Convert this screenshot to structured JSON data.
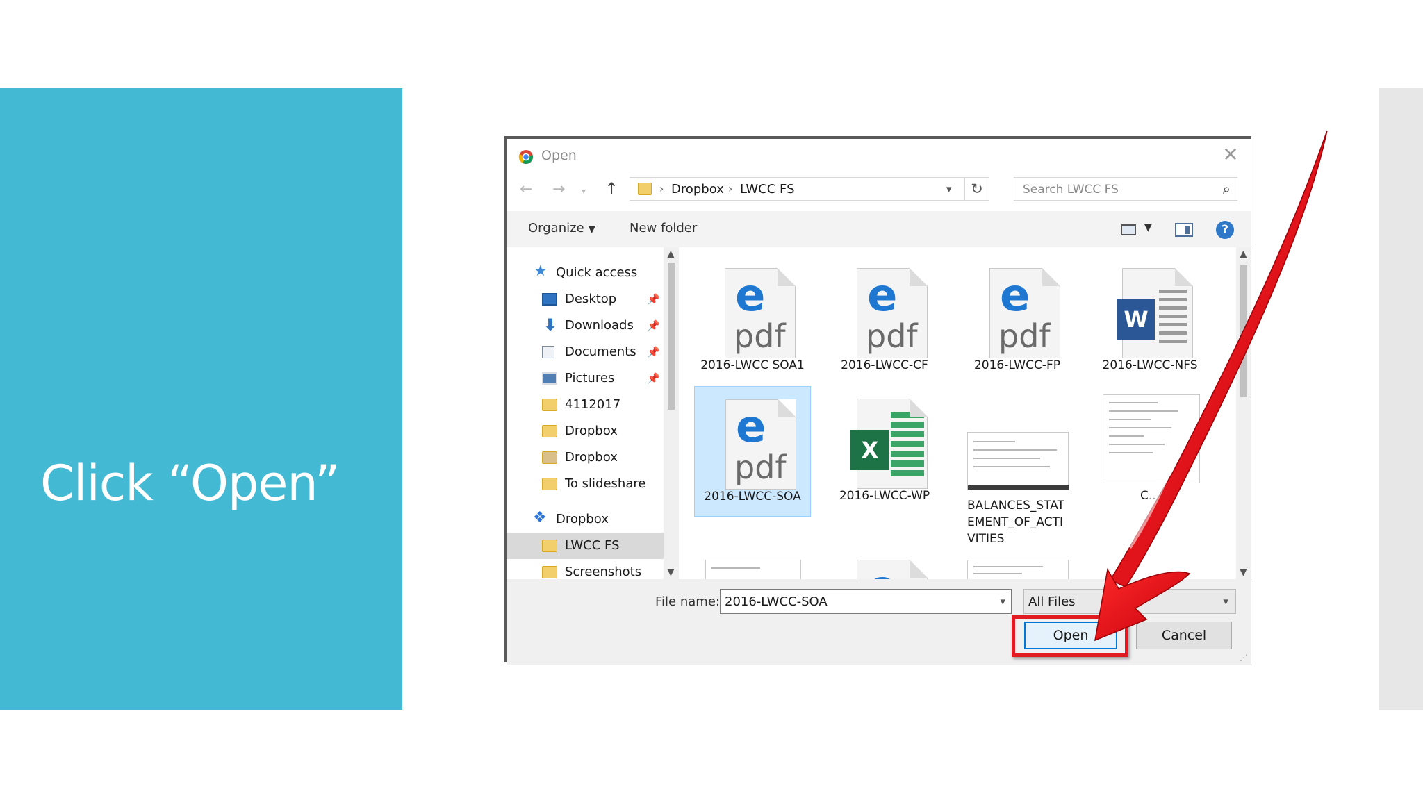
{
  "slide": {
    "title": "Click “Open”",
    "panel_color": "#43b9d4"
  },
  "dialog": {
    "title": "Open",
    "close_icon": "close-icon",
    "nav": {
      "back_icon": "arrow-left-icon",
      "forward_icon": "arrow-right-icon",
      "recent_icon": "chevron-down-icon",
      "up_icon": "arrow-up-icon"
    },
    "address": {
      "crumbs": [
        "Dropbox",
        "LWCC FS"
      ],
      "refresh_icon": "refresh-icon"
    },
    "search": {
      "placeholder": "Search LWCC FS",
      "icon": "search-icon"
    },
    "toolbar": {
      "organize_label": "Organize",
      "new_folder_label": "New folder",
      "help_label": "?"
    },
    "nav_pane": {
      "items": [
        {
          "label": "Quick access",
          "icon": "star-icon"
        },
        {
          "label": "Desktop",
          "icon": "desktop-icon",
          "pinned": true
        },
        {
          "label": "Downloads",
          "icon": "download-icon",
          "pinned": true
        },
        {
          "label": "Documents",
          "icon": "documents-icon",
          "pinned": true
        },
        {
          "label": "Pictures",
          "icon": "pictures-icon",
          "pinned": true
        },
        {
          "label": "4112017",
          "icon": "folder-icon"
        },
        {
          "label": "Dropbox",
          "icon": "folder-icon"
        },
        {
          "label": "Dropbox",
          "icon": "shared-folder-icon"
        },
        {
          "label": "To slideshare",
          "icon": "folder-icon"
        },
        {
          "label": "Dropbox",
          "icon": "dropbox-icon"
        },
        {
          "label": "LWCC FS",
          "icon": "folder-icon",
          "selected": true
        },
        {
          "label": "Screenshots",
          "icon": "folder-icon"
        }
      ]
    },
    "files": [
      {
        "name": "2016-LWCC SOA1",
        "type": "pdf"
      },
      {
        "name": "2016-LWCC-CF",
        "type": "pdf"
      },
      {
        "name": "2016-LWCC-FP",
        "type": "pdf"
      },
      {
        "name": "2016-LWCC-NFS",
        "type": "word"
      },
      {
        "name": "2016-LWCC-SOA",
        "type": "pdf",
        "selected": true
      },
      {
        "name": "2016-LWCC-WP",
        "type": "excel"
      },
      {
        "name_lines": [
          "BALANCES_STAT",
          "EMENT_OF_ACTI",
          "VITIES"
        ],
        "type": "image"
      },
      {
        "name": "C...",
        "type": "document-thumb"
      }
    ],
    "filename": {
      "label": "File name:",
      "value": "2016-LWCC-SOA"
    },
    "filetype": {
      "value": "All Files"
    },
    "buttons": {
      "open_label": "Open",
      "cancel_label": "Cancel"
    }
  },
  "annotation": {
    "highlight_color": "#e01b22"
  }
}
